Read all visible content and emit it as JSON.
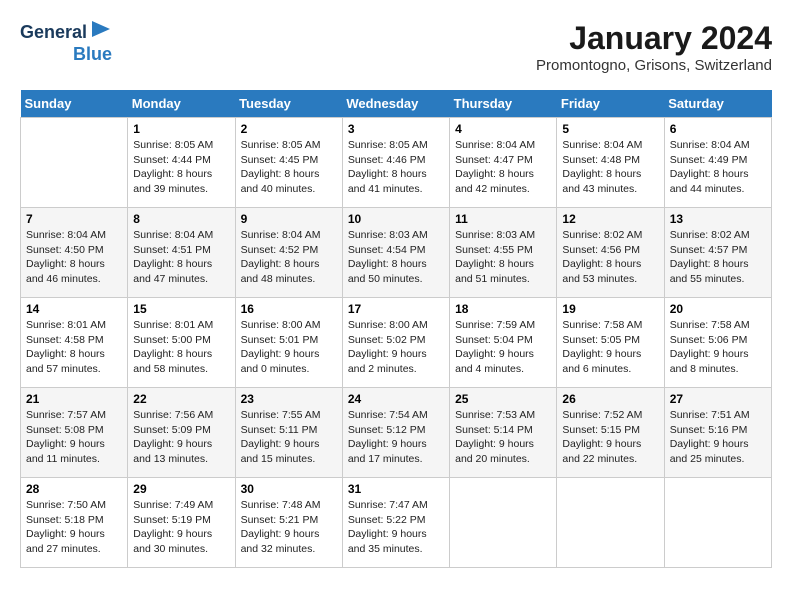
{
  "header": {
    "logo_line1": "General",
    "logo_line2": "Blue",
    "title": "January 2024",
    "subtitle": "Promontogno, Grisons, Switzerland"
  },
  "days_of_week": [
    "Sunday",
    "Monday",
    "Tuesday",
    "Wednesday",
    "Thursday",
    "Friday",
    "Saturday"
  ],
  "weeks": [
    [
      {
        "day": "",
        "info": ""
      },
      {
        "day": "1",
        "info": "Sunrise: 8:05 AM\nSunset: 4:44 PM\nDaylight: 8 hours\nand 39 minutes."
      },
      {
        "day": "2",
        "info": "Sunrise: 8:05 AM\nSunset: 4:45 PM\nDaylight: 8 hours\nand 40 minutes."
      },
      {
        "day": "3",
        "info": "Sunrise: 8:05 AM\nSunset: 4:46 PM\nDaylight: 8 hours\nand 41 minutes."
      },
      {
        "day": "4",
        "info": "Sunrise: 8:04 AM\nSunset: 4:47 PM\nDaylight: 8 hours\nand 42 minutes."
      },
      {
        "day": "5",
        "info": "Sunrise: 8:04 AM\nSunset: 4:48 PM\nDaylight: 8 hours\nand 43 minutes."
      },
      {
        "day": "6",
        "info": "Sunrise: 8:04 AM\nSunset: 4:49 PM\nDaylight: 8 hours\nand 44 minutes."
      }
    ],
    [
      {
        "day": "7",
        "info": "Sunrise: 8:04 AM\nSunset: 4:50 PM\nDaylight: 8 hours\nand 46 minutes."
      },
      {
        "day": "8",
        "info": "Sunrise: 8:04 AM\nSunset: 4:51 PM\nDaylight: 8 hours\nand 47 minutes."
      },
      {
        "day": "9",
        "info": "Sunrise: 8:04 AM\nSunset: 4:52 PM\nDaylight: 8 hours\nand 48 minutes."
      },
      {
        "day": "10",
        "info": "Sunrise: 8:03 AM\nSunset: 4:54 PM\nDaylight: 8 hours\nand 50 minutes."
      },
      {
        "day": "11",
        "info": "Sunrise: 8:03 AM\nSunset: 4:55 PM\nDaylight: 8 hours\nand 51 minutes."
      },
      {
        "day": "12",
        "info": "Sunrise: 8:02 AM\nSunset: 4:56 PM\nDaylight: 8 hours\nand 53 minutes."
      },
      {
        "day": "13",
        "info": "Sunrise: 8:02 AM\nSunset: 4:57 PM\nDaylight: 8 hours\nand 55 minutes."
      }
    ],
    [
      {
        "day": "14",
        "info": "Sunrise: 8:01 AM\nSunset: 4:58 PM\nDaylight: 8 hours\nand 57 minutes."
      },
      {
        "day": "15",
        "info": "Sunrise: 8:01 AM\nSunset: 5:00 PM\nDaylight: 8 hours\nand 58 minutes."
      },
      {
        "day": "16",
        "info": "Sunrise: 8:00 AM\nSunset: 5:01 PM\nDaylight: 9 hours\nand 0 minutes."
      },
      {
        "day": "17",
        "info": "Sunrise: 8:00 AM\nSunset: 5:02 PM\nDaylight: 9 hours\nand 2 minutes."
      },
      {
        "day": "18",
        "info": "Sunrise: 7:59 AM\nSunset: 5:04 PM\nDaylight: 9 hours\nand 4 minutes."
      },
      {
        "day": "19",
        "info": "Sunrise: 7:58 AM\nSunset: 5:05 PM\nDaylight: 9 hours\nand 6 minutes."
      },
      {
        "day": "20",
        "info": "Sunrise: 7:58 AM\nSunset: 5:06 PM\nDaylight: 9 hours\nand 8 minutes."
      }
    ],
    [
      {
        "day": "21",
        "info": "Sunrise: 7:57 AM\nSunset: 5:08 PM\nDaylight: 9 hours\nand 11 minutes."
      },
      {
        "day": "22",
        "info": "Sunrise: 7:56 AM\nSunset: 5:09 PM\nDaylight: 9 hours\nand 13 minutes."
      },
      {
        "day": "23",
        "info": "Sunrise: 7:55 AM\nSunset: 5:11 PM\nDaylight: 9 hours\nand 15 minutes."
      },
      {
        "day": "24",
        "info": "Sunrise: 7:54 AM\nSunset: 5:12 PM\nDaylight: 9 hours\nand 17 minutes."
      },
      {
        "day": "25",
        "info": "Sunrise: 7:53 AM\nSunset: 5:14 PM\nDaylight: 9 hours\nand 20 minutes."
      },
      {
        "day": "26",
        "info": "Sunrise: 7:52 AM\nSunset: 5:15 PM\nDaylight: 9 hours\nand 22 minutes."
      },
      {
        "day": "27",
        "info": "Sunrise: 7:51 AM\nSunset: 5:16 PM\nDaylight: 9 hours\nand 25 minutes."
      }
    ],
    [
      {
        "day": "28",
        "info": "Sunrise: 7:50 AM\nSunset: 5:18 PM\nDaylight: 9 hours\nand 27 minutes."
      },
      {
        "day": "29",
        "info": "Sunrise: 7:49 AM\nSunset: 5:19 PM\nDaylight: 9 hours\nand 30 minutes."
      },
      {
        "day": "30",
        "info": "Sunrise: 7:48 AM\nSunset: 5:21 PM\nDaylight: 9 hours\nand 32 minutes."
      },
      {
        "day": "31",
        "info": "Sunrise: 7:47 AM\nSunset: 5:22 PM\nDaylight: 9 hours\nand 35 minutes."
      },
      {
        "day": "",
        "info": ""
      },
      {
        "day": "",
        "info": ""
      },
      {
        "day": "",
        "info": ""
      }
    ]
  ]
}
